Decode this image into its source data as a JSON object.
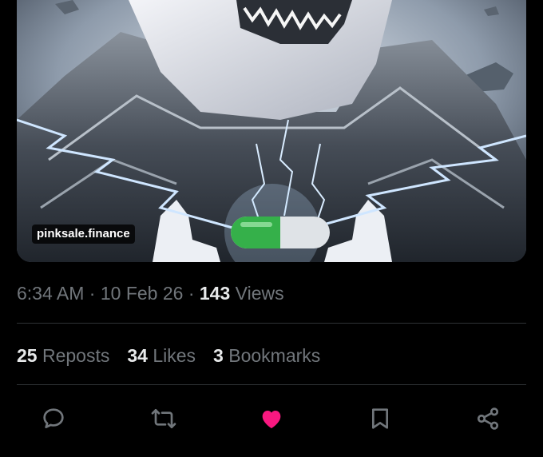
{
  "post": {
    "media": {
      "alt_icon": "shark-astronaut-illustration",
      "watermark": "pinksale.finance"
    },
    "time": "6:34 AM",
    "separator": "·",
    "date": "10 Feb 26",
    "views_count": "143",
    "views_label": "Views",
    "stats": {
      "reposts_count": "25",
      "reposts_label": "Reposts",
      "likes_count": "34",
      "likes_label": "Likes",
      "bookmarks_count": "3",
      "bookmarks_label": "Bookmarks"
    },
    "actions": {
      "reply_icon": "reply-icon",
      "repost_icon": "repost-icon",
      "like_icon": "heart-icon",
      "like_active_color": "#f91880",
      "bookmark_icon": "bookmark-icon",
      "share_icon": "share-icon",
      "icon_color": "#71767b"
    }
  }
}
